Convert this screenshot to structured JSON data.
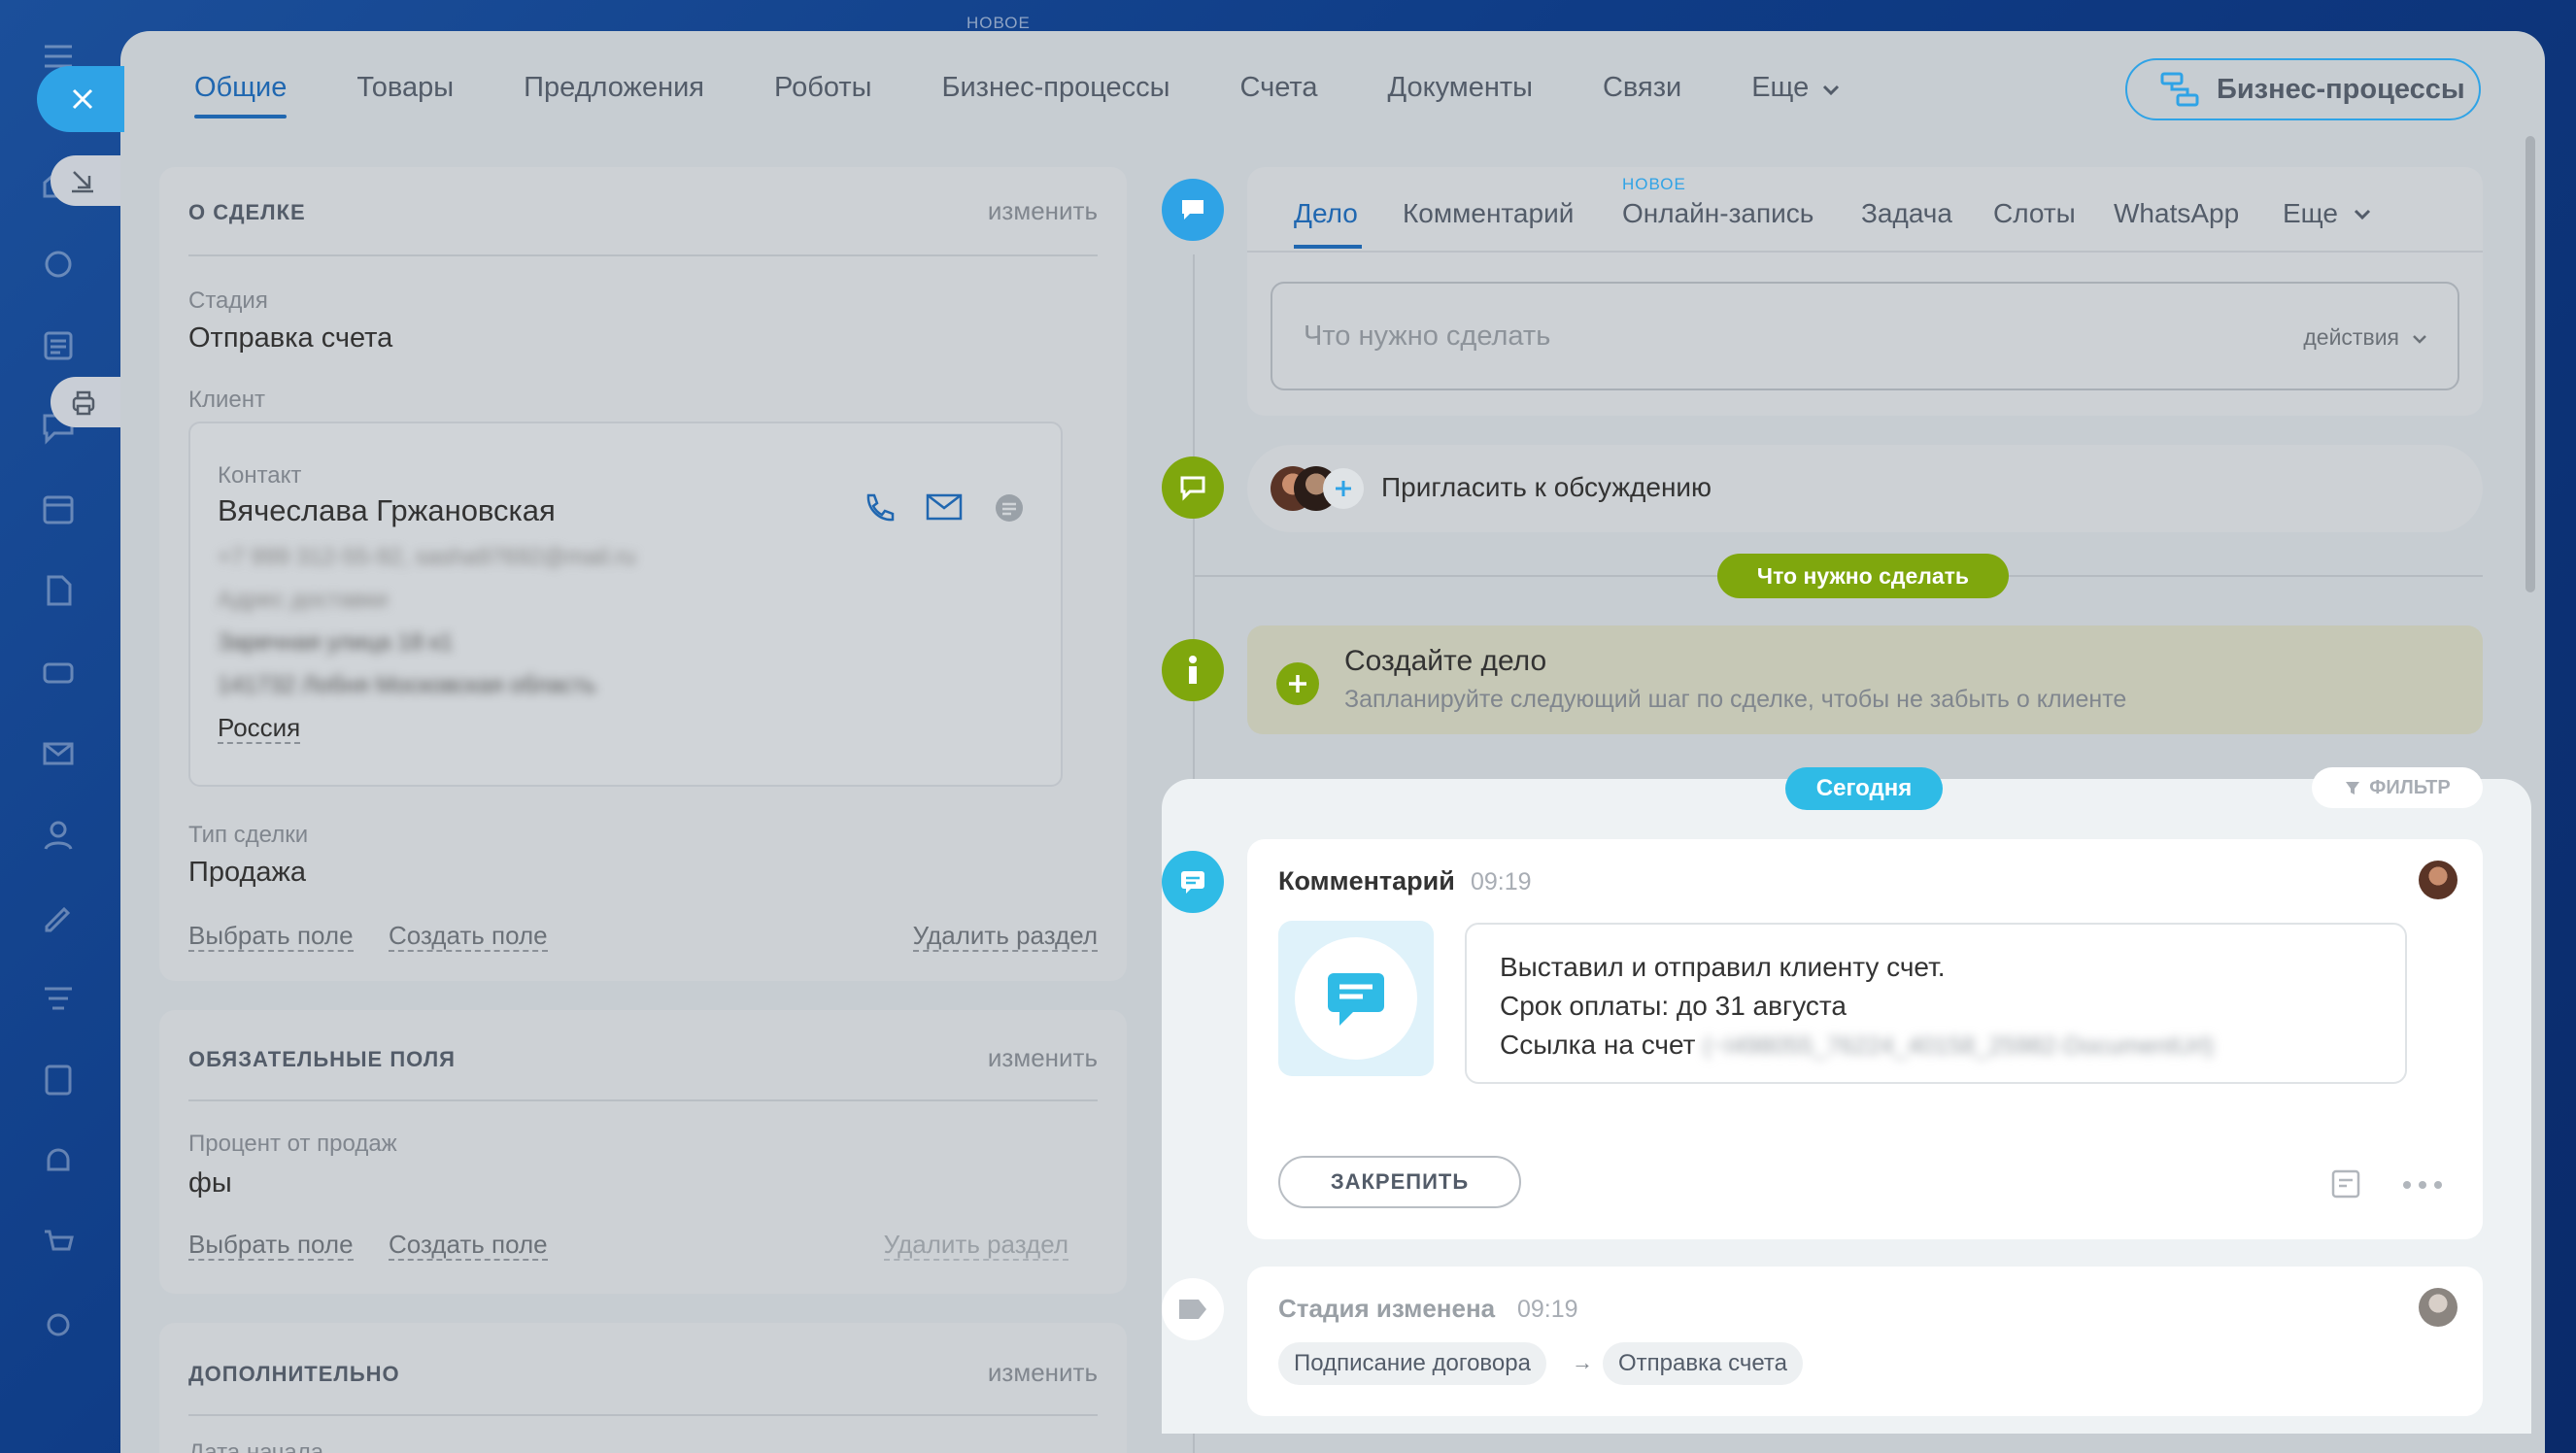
{
  "header": {
    "new_label": "НОВОЕ",
    "tabs": [
      {
        "label": "Общие",
        "active": true
      },
      {
        "label": "Товары"
      },
      {
        "label": "Предложения"
      },
      {
        "label": "Роботы"
      },
      {
        "label": "Бизнес-процессы"
      },
      {
        "label": "Счета"
      },
      {
        "label": "Документы"
      },
      {
        "label": "Связи"
      },
      {
        "label": "Еще"
      }
    ],
    "bp_button": "Бизнес-процессы"
  },
  "about": {
    "title": "О СДЕЛКЕ",
    "edit": "изменить",
    "stage_label": "Стадия",
    "stage_value": "Отправка счета",
    "client_label": "Клиент",
    "contact_label": "Контакт",
    "contact_name": "Вячеслава Гржановская",
    "contact_phone_email": "+7 999 312-55-92, sasha97692@mail.ru",
    "delivery_label": "Адрес доставки",
    "address_line1": "Заречная улица 18 к1",
    "address_line2": "141732 Лобня Московская область",
    "country": "Россия",
    "deal_type_label": "Тип сделки",
    "deal_type_value": "Продажа",
    "select_field": "Выбрать поле",
    "create_field": "Создать поле",
    "delete_section": "Удалить раздел"
  },
  "required": {
    "title": "ОБЯЗАТЕЛЬНЫЕ ПОЛЯ",
    "edit": "изменить",
    "percent_label": "Процент от продаж",
    "percent_value": "фы",
    "select_field": "Выбрать поле",
    "create_field": "Создать поле",
    "delete_section": "Удалить раздел"
  },
  "extra": {
    "title": "ДОПОЛНИТЕЛЬНО",
    "edit": "изменить",
    "start_date_label": "Дата начала"
  },
  "activity": {
    "new_badge": "НОВОЕ",
    "tabs": [
      {
        "label": "Дело",
        "active": true
      },
      {
        "label": "Комментарий"
      },
      {
        "label": "Онлайн-запись"
      },
      {
        "label": "Задача"
      },
      {
        "label": "Слоты"
      },
      {
        "label": "WhatsApp"
      },
      {
        "label": "Еще"
      }
    ],
    "input_placeholder": "Что нужно сделать",
    "actions_label": "действия"
  },
  "invite": {
    "label": "Пригласить к обсуждению"
  },
  "todo_pill": "Что нужно сделать",
  "create_task": {
    "title": "Создайте дело",
    "subtitle": "Запланируйте следующий шаг по сделке, чтобы не забыть о клиенте"
  },
  "timeline": {
    "today": "Сегодня",
    "filter": "ФИЛЬТР",
    "comment": {
      "title": "Комментарий",
      "time": "09:19",
      "line1": "Выставил и отправил клиенту счет.",
      "line2": "Срок оплаты: до 31 августа",
      "line3_prefix": "Ссылка на счет",
      "line3_link": "(~I498055_76224_40158_25982-DocumentUrl)",
      "pin": "ЗАКРЕПИТЬ"
    },
    "stage": {
      "title": "Стадия изменена",
      "time": "09:19",
      "from": "Подписание договора",
      "arrow": "→",
      "to": "Отправка счета"
    }
  },
  "colors": {
    "accent": "#2067b0",
    "cyan": "#2fbbe6",
    "green": "#7fa70d"
  }
}
